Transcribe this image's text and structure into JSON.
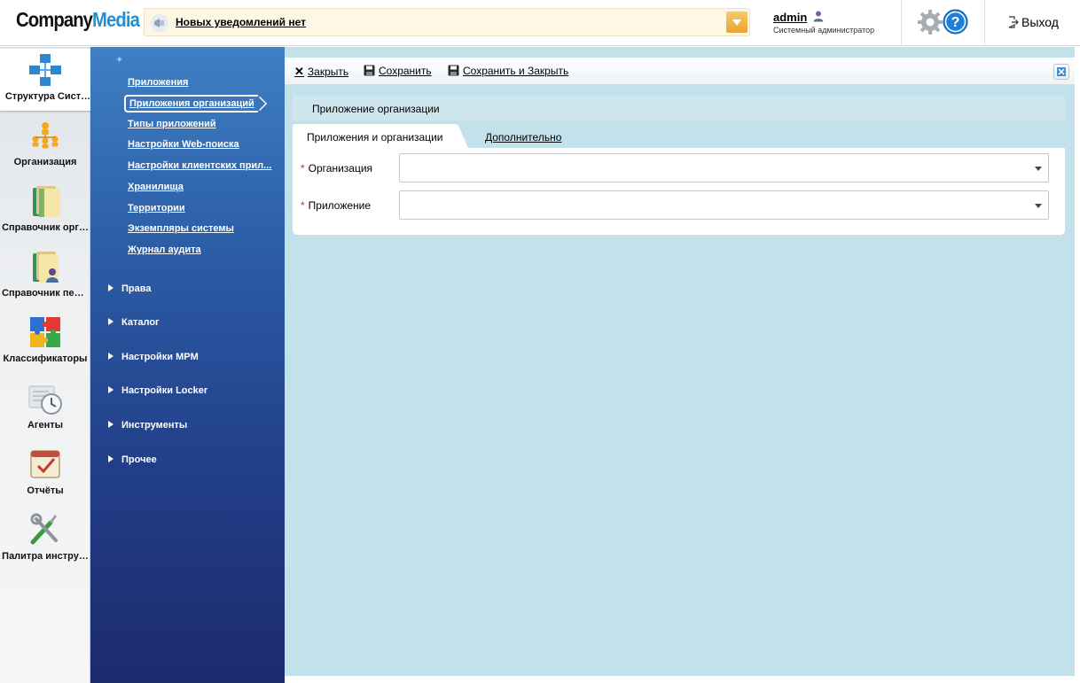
{
  "header": {
    "logo_part1": "Company",
    "logo_part2": "Media",
    "notification_text": "Новых уведомлений нет",
    "user_name": "admin",
    "user_role": "Системный администратор",
    "logout_label": "Выход",
    "help_icon": "question-icon",
    "settings_icon": "gear-icon"
  },
  "iconbar": {
    "items": [
      {
        "label": "Структура Сист…",
        "icon": "system-structure-icon",
        "active": true
      },
      {
        "label": "Организация",
        "icon": "organization-icon"
      },
      {
        "label": "Справочник орг…",
        "icon": "folder-icon"
      },
      {
        "label": "Справочник пер…",
        "icon": "folder-person-icon"
      },
      {
        "label": "Классификаторы",
        "icon": "puzzle-icon"
      },
      {
        "label": "Агенты",
        "icon": "clock-icon"
      },
      {
        "label": "Отчёты",
        "icon": "calendar-check-icon"
      },
      {
        "label": "Палитра инстру…",
        "icon": "tools-icon"
      }
    ]
  },
  "nav": {
    "links": [
      "Приложения",
      "Приложения организаций",
      "Типы приложений",
      "Настройки Web-поиска",
      "Настройки клиентских прил...",
      "Хранилища",
      "Территории",
      "Экземпляры системы",
      "Журнал аудита"
    ],
    "selected_index": 1,
    "groups": [
      "Права",
      "Каталог",
      "Настройки MPM",
      "Настройки Locker",
      "Инструменты",
      "Прочее"
    ]
  },
  "toolbar": {
    "close_label": "Закрыть",
    "save_label": "Сохранить",
    "save_close_label": "Сохранить и Закрыть"
  },
  "form": {
    "title": "Приложение организации",
    "tabs": [
      "Приложения и организации",
      "Дополнительно"
    ],
    "required_mark": "*",
    "fields": [
      {
        "label": "Организация",
        "value": ""
      },
      {
        "label": "Приложение",
        "value": ""
      }
    ]
  },
  "colors": {
    "accent": "#1f8fd6",
    "nav_top": "#3f7fc3",
    "nav_bottom": "#1c2a6c",
    "main_bg": "#c2e1eb",
    "required": "#d9251d"
  }
}
